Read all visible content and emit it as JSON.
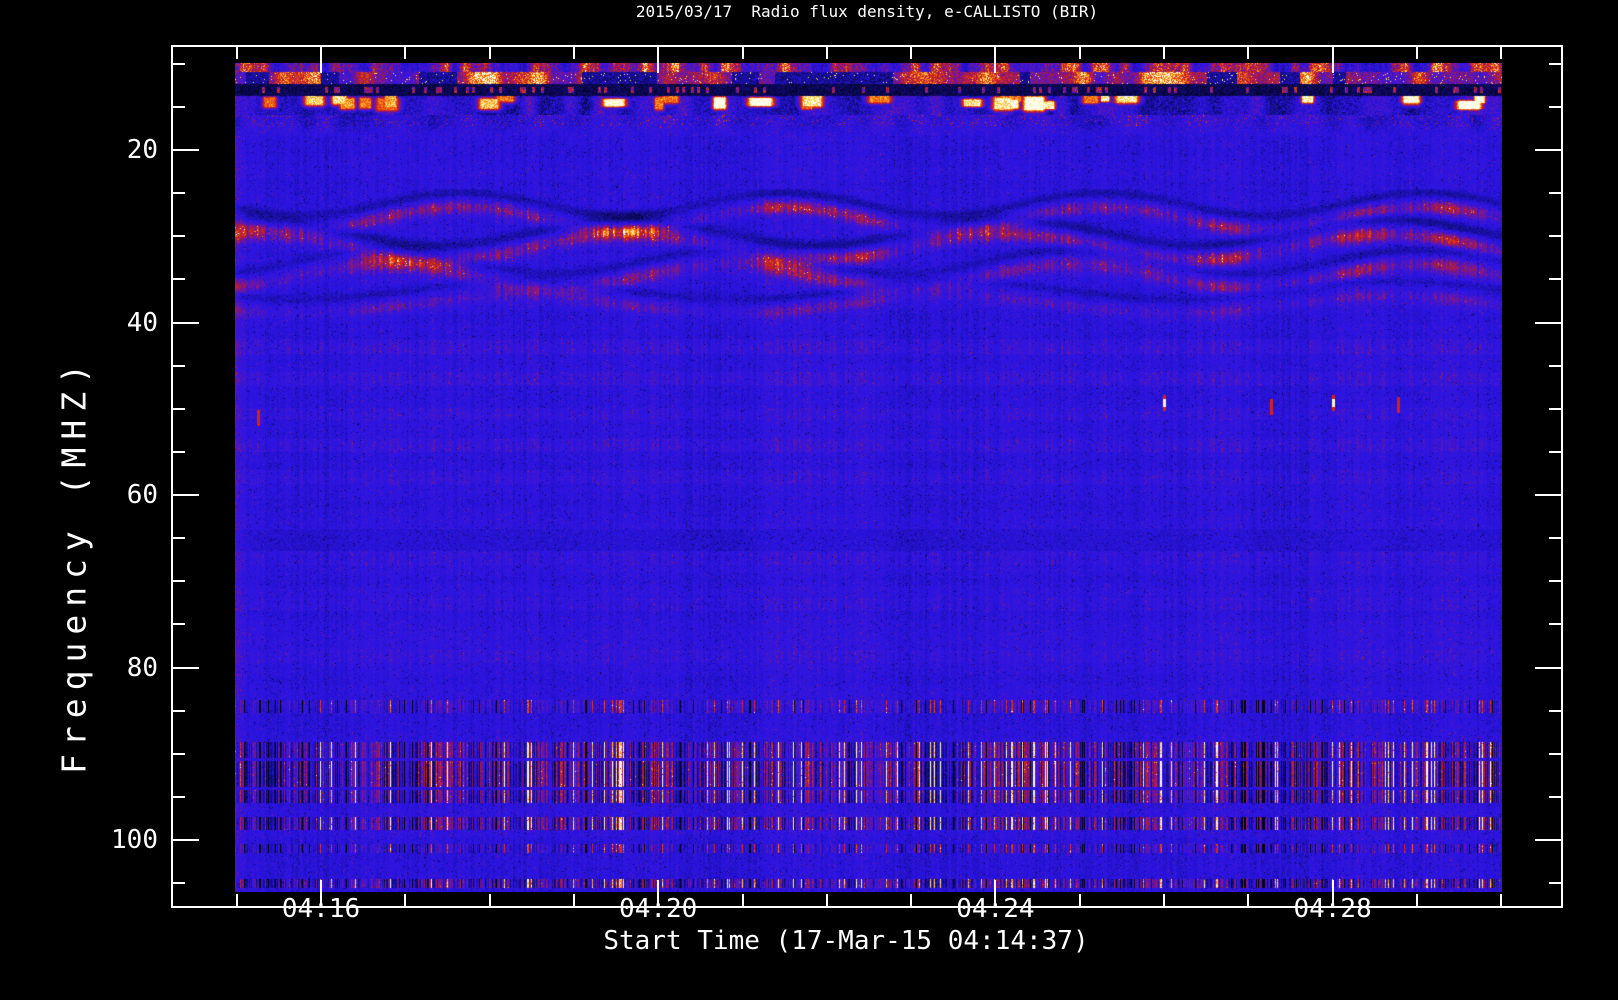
{
  "window": {
    "background": "#000000",
    "foreground": "#ffffff"
  },
  "chart_data": {
    "type": "heatmap",
    "title": "2015/03/17  Radio flux density, e-CALLISTO (BIR)",
    "xlabel": "Start Time (17-Mar-15 04:14:37)",
    "ylabel": "Frequency (MHZ)",
    "instrument": "e-CALLISTO",
    "station": "BIR",
    "date": "2015/03/17",
    "start_time": "04:14:37",
    "x_axis": {
      "unit": "time (UT)",
      "major_ticks": [
        {
          "minutes": 16,
          "label": "04:16"
        },
        {
          "minutes": 20,
          "label": "04:20"
        },
        {
          "minutes": 24,
          "label": "04:24"
        },
        {
          "minutes": 28,
          "label": "04:28"
        }
      ],
      "minor_tick_minutes": [
        15,
        17,
        18,
        19,
        21,
        22,
        23,
        25,
        26,
        27,
        29,
        30
      ],
      "frame_range_minutes": [
        14.22,
        30.73
      ],
      "data_range_minutes": [
        15.0,
        30.03
      ]
    },
    "y_axis": {
      "unit": "MHz",
      "direction": "increasing downward",
      "major_ticks": [
        20,
        40,
        60,
        80,
        100
      ],
      "minor_tick_mhz": [
        10,
        15,
        25,
        30,
        35,
        45,
        50,
        55,
        65,
        70,
        75,
        85,
        90,
        95,
        105
      ],
      "frame_range_mhz": [
        7.8,
        107.9
      ],
      "data_range_mhz": [
        9.9,
        106.0
      ]
    },
    "palette": {
      "description": "blue background spectrogram colormap: black -> navy -> blue -> purple -> red -> orange -> yellow -> white",
      "stops": [
        [
          0.0,
          [
            0,
            0,
            0
          ]
        ],
        [
          0.14,
          [
            8,
            6,
            64
          ]
        ],
        [
          0.3,
          [
            22,
            14,
            150
          ]
        ],
        [
          0.44,
          [
            42,
            20,
            228
          ]
        ],
        [
          0.56,
          [
            58,
            22,
            214
          ]
        ],
        [
          0.66,
          [
            112,
            22,
            160
          ]
        ],
        [
          0.74,
          [
            160,
            26,
            80
          ]
        ],
        [
          0.82,
          [
            212,
            34,
            28
          ]
        ],
        [
          0.9,
          [
            248,
            114,
            16
          ]
        ],
        [
          0.955,
          [
            255,
            208,
            60
          ]
        ],
        [
          1.0,
          [
            255,
            255,
            236
          ]
        ]
      ],
      "base_blue": "#2a14e4",
      "rfi_red": "#d42219",
      "burst_yellow": "#ffd03c"
    },
    "features": {
      "top_rfi_band": {
        "freq_mhz": [
          9.9,
          18.3
        ],
        "description": "strong broadband interference: red/orange rows, yellow-white bursts, black dropout lane near 12.3-13.7 MHz",
        "zones_mhz": {
          "mottle": [
            9.9,
            10.9
          ],
          "red_band": [
            10.9,
            12.3
          ],
          "dark_lane": [
            12.3,
            13.7
          ],
          "burst_row": [
            13.7,
            15.9
          ],
          "speckle": [
            15.9,
            17.1
          ],
          "fade": [
            17.1,
            18.3
          ]
        }
      },
      "wavy_bands": {
        "freq_mhz": [
          24.5,
          40.5
        ],
        "description": "undulating faint red/purple ionospheric ripple bands over blue background",
        "bands": [
          {
            "f": 27.9,
            "amp": 1.3,
            "wl": 3.8,
            "ph": 0.6,
            "hw": 0.85,
            "s": 0.2
          },
          {
            "f": 31.2,
            "amp": 1.5,
            "wl": 4.5,
            "ph": 2.4,
            "hw": 0.95,
            "s": 0.22
          },
          {
            "f": 34.6,
            "amp": 1.4,
            "wl": 4.1,
            "ph": 4.2,
            "hw": 0.95,
            "s": 0.17
          },
          {
            "f": 37.9,
            "amp": 1.1,
            "wl": 5.2,
            "ph": 1.4,
            "hw": 0.8,
            "s": 0.12
          },
          {
            "f": 26.2,
            "amp": 1.3,
            "wl": 3.8,
            "ph": 0.6,
            "hw": 0.6,
            "s": -0.13
          },
          {
            "f": 29.5,
            "amp": 1.5,
            "wl": 4.5,
            "ph": 2.4,
            "hw": 0.7,
            "s": -0.15
          },
          {
            "f": 32.9,
            "amp": 1.4,
            "wl": 4.1,
            "ph": 4.2,
            "hw": 0.7,
            "s": -0.12
          },
          {
            "f": 36.2,
            "amp": 1.1,
            "wl": 5.2,
            "ph": 1.4,
            "hw": 0.55,
            "s": -0.09
          }
        ]
      },
      "faint_stripes": [
        {
          "f0": 42.0,
          "f1": 43.6,
          "s": 0.05
        },
        {
          "f0": 45.8,
          "f1": 47.2,
          "s": 0.045
        },
        {
          "f0": 50.0,
          "f1": 51.2,
          "s": 0.035
        },
        {
          "f0": 53.6,
          "f1": 55.0,
          "s": 0.05
        },
        {
          "f0": 57.2,
          "f1": 58.6,
          "s": 0.04
        },
        {
          "f0": 64.0,
          "f1": 66.4,
          "s": -0.05
        },
        {
          "f0": 66.6,
          "f1": 68.0,
          "s": 0.045
        },
        {
          "f0": 72.0,
          "f1": 73.4,
          "s": 0.04
        },
        {
          "f0": 78.0,
          "f1": 79.4,
          "s": 0.035
        }
      ],
      "fm_band_rfi": {
        "description": "speckled horizontal interference stripes (black/red/blue) in and near FM broadcast band",
        "stripes": [
          {
            "f0": 83.8,
            "f1": 85.2,
            "s": 0.13
          },
          {
            "f0": 88.7,
            "f1": 90.4,
            "s": 0.26
          },
          {
            "f0": 90.9,
            "f1": 93.8,
            "s": 0.33
          },
          {
            "f0": 94.2,
            "f1": 95.6,
            "s": 0.27
          },
          {
            "f0": 97.4,
            "f1": 98.8,
            "s": 0.27
          },
          {
            "f0": 100.5,
            "f1": 101.4,
            "s": 0.15
          },
          {
            "f0": 104.6,
            "f1": 105.5,
            "s": 0.26
          }
        ]
      },
      "point_bursts": [
        {
          "t_min": 15.25,
          "f_mhz": 51.1,
          "core": false
        },
        {
          "t_min": 26.0,
          "f_mhz": 49.3,
          "core": true
        },
        {
          "t_min": 27.27,
          "f_mhz": 49.8,
          "core": false
        },
        {
          "t_min": 28.0,
          "f_mhz": 49.3,
          "core": true
        },
        {
          "t_min": 28.78,
          "f_mhz": 49.6,
          "core": false
        }
      ]
    }
  }
}
